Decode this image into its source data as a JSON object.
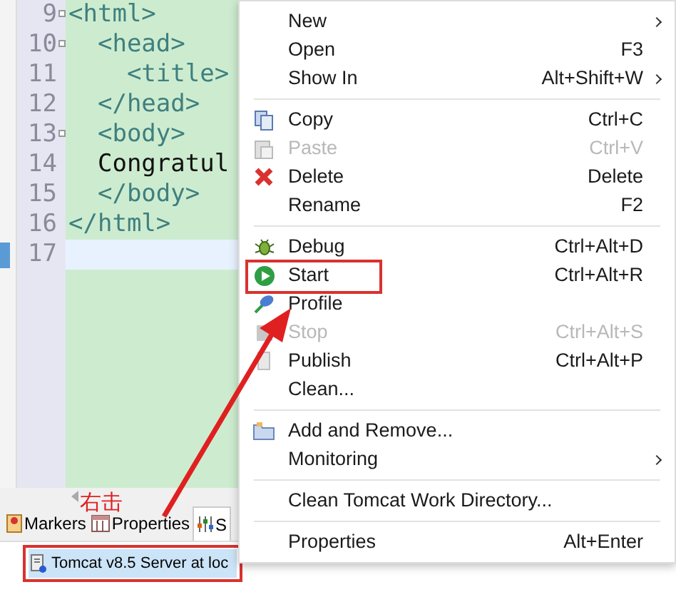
{
  "editor": {
    "lines": [
      {
        "number": "9",
        "text": "<html>",
        "kind": "tag",
        "foldable": true,
        "current": false
      },
      {
        "number": "10",
        "text": "  <head>",
        "kind": "tag",
        "foldable": true,
        "current": false
      },
      {
        "number": "11",
        "text": "    <title>",
        "kind": "tag",
        "foldable": false,
        "current": false
      },
      {
        "number": "12",
        "text": "  </head>",
        "kind": "tag",
        "foldable": false,
        "current": false
      },
      {
        "number": "13",
        "text": "  <body>",
        "kind": "tag",
        "foldable": true,
        "current": false
      },
      {
        "number": "14",
        "text": "  Congratul",
        "kind": "text",
        "foldable": false,
        "current": false
      },
      {
        "number": "15",
        "text": "  </body>",
        "kind": "tag",
        "foldable": false,
        "current": false
      },
      {
        "number": "16",
        "text": "</html>",
        "kind": "tag",
        "foldable": false,
        "current": false
      },
      {
        "number": "17",
        "foldable": false,
        "current": true
      }
    ]
  },
  "bottom_panel": {
    "tabs": [
      {
        "label": "Markers",
        "selected": false
      },
      {
        "label": "Properties",
        "selected": false
      },
      {
        "label": "S",
        "selected": true
      }
    ],
    "servers": [
      {
        "name": "Tomcat v8.5 Server at loc",
        "selected": true
      }
    ]
  },
  "context_menu": {
    "items": [
      {
        "kind": "item",
        "label": "New",
        "submenu": true,
        "disabled": false
      },
      {
        "kind": "item",
        "label": "Open",
        "shortcut": "F3",
        "submenu": false,
        "disabled": false
      },
      {
        "kind": "item",
        "label": "Show In",
        "shortcut": "Alt+Shift+W",
        "submenu": true,
        "disabled": false
      },
      {
        "kind": "separator"
      },
      {
        "kind": "item",
        "label": "Copy",
        "shortcut": "Ctrl+C",
        "submenu": false,
        "disabled": false
      },
      {
        "kind": "item",
        "label": "Paste",
        "shortcut": "Ctrl+V",
        "submenu": false,
        "disabled": true
      },
      {
        "kind": "item",
        "label": "Delete",
        "shortcut": "Delete",
        "submenu": false,
        "disabled": false
      },
      {
        "kind": "item",
        "label": "Rename",
        "shortcut": "F2",
        "submenu": false,
        "disabled": false
      },
      {
        "kind": "separator"
      },
      {
        "kind": "item",
        "label": "Debug",
        "shortcut": "Ctrl+Alt+D",
        "submenu": false,
        "disabled": false
      },
      {
        "kind": "item",
        "label": "Start",
        "shortcut": "Ctrl+Alt+R",
        "submenu": false,
        "disabled": false
      },
      {
        "kind": "item",
        "label": "Profile",
        "submenu": false,
        "disabled": false
      },
      {
        "kind": "item",
        "label": "Stop",
        "shortcut": "Ctrl+Alt+S",
        "submenu": false,
        "disabled": true
      },
      {
        "kind": "item",
        "label": "Publish",
        "shortcut": "Ctrl+Alt+P",
        "submenu": false,
        "disabled": false
      },
      {
        "kind": "item",
        "label": "Clean...",
        "submenu": false,
        "disabled": false
      },
      {
        "kind": "separator"
      },
      {
        "kind": "item",
        "label": "Add and Remove...",
        "submenu": false,
        "disabled": false
      },
      {
        "kind": "item",
        "label": "Monitoring",
        "submenu": true,
        "disabled": false
      },
      {
        "kind": "separator"
      },
      {
        "kind": "item",
        "label": "Clean Tomcat Work Directory...",
        "submenu": false,
        "disabled": false
      },
      {
        "kind": "separator"
      },
      {
        "kind": "item",
        "label": "Properties",
        "shortcut": "Alt+Enter",
        "submenu": false,
        "disabled": false
      }
    ]
  },
  "annotation": {
    "text": "右击"
  }
}
